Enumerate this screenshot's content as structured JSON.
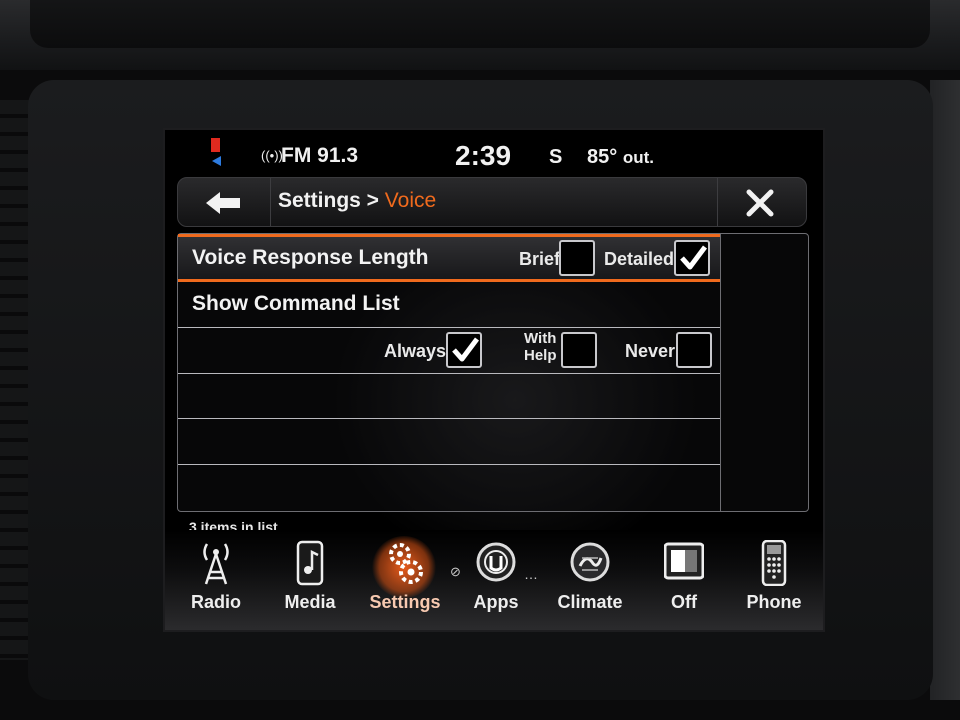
{
  "status_bar": {
    "radio": "FM 91.3",
    "time": "2:39",
    "compass": "S",
    "temperature": "85°",
    "temperature_suffix": "out."
  },
  "header": {
    "breadcrumb_parent": "Settings >",
    "breadcrumb_current": "Voice",
    "back_icon": "back-arrow-icon",
    "close_icon": "close-icon"
  },
  "list": {
    "rows": [
      {
        "label": "Voice Response Length",
        "selected": true,
        "options": [
          {
            "label": "Brief",
            "checked": false
          },
          {
            "label": "Detailed",
            "checked": true
          }
        ]
      },
      {
        "label": "Show Command List",
        "options": [
          {
            "label": "Always",
            "checked": true
          },
          {
            "label": "With Help",
            "label_line1": "With",
            "label_line2": "Help",
            "checked": false
          },
          {
            "label": "Never",
            "checked": false
          }
        ]
      }
    ],
    "count_text": "3 items in list"
  },
  "nav": {
    "items": [
      {
        "label": "Radio",
        "icon": "radio-tower-icon"
      },
      {
        "label": "Media",
        "icon": "media-icon"
      },
      {
        "label": "Settings",
        "icon": "gears-icon",
        "active": true
      },
      {
        "label": "Apps",
        "icon": "apps-icon"
      },
      {
        "label": "Climate",
        "icon": "climate-icon"
      },
      {
        "label": "Off",
        "icon": "display-off-icon"
      },
      {
        "label": "Phone",
        "icon": "phone-icon"
      }
    ]
  },
  "colors": {
    "accent": "#f06a1d",
    "text": "#f1f1f1",
    "background": "#000000"
  }
}
